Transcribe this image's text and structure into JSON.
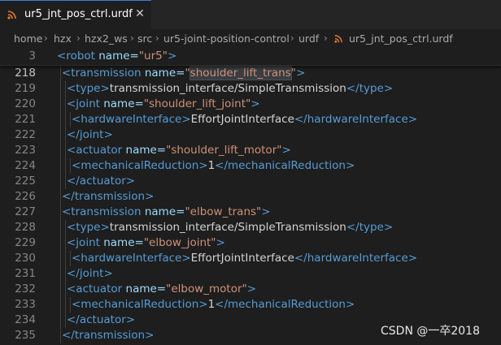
{
  "tab": {
    "label": "ur5_jnt_pos_ctrl.urdf",
    "close_glyph": "✕",
    "icon": "rss-icon"
  },
  "breadcrumb": [
    "home",
    "hzx",
    "hzx2_ws",
    "src",
    "ur5-joint-position-control",
    "urdf",
    "ur5_jnt_pos_ctrl.urdf"
  ],
  "sticky": {
    "number": "3",
    "tag_open": "<robot",
    "attr": " name=",
    "value": "\"ur5\"",
    "tag_close": ">"
  },
  "lines": [
    {
      "n": "218",
      "parts": [
        [
          "tag",
          "<transmission"
        ],
        [
          "attr",
          " name="
        ],
        [
          "str",
          "\"shoulder_lift_trans\"",
          "hl"
        ],
        [
          "tag",
          ">"
        ]
      ]
    },
    {
      "n": "219",
      "parts": [
        [
          "tag",
          "<type>"
        ],
        [
          "txt",
          "transmission_interface/SimpleTransmission"
        ],
        [
          "tag",
          "</type>"
        ]
      ]
    },
    {
      "n": "220",
      "parts": [
        [
          "tag",
          "<joint"
        ],
        [
          "attr",
          " name="
        ],
        [
          "str",
          "\"shoulder_lift_joint\""
        ],
        [
          "tag",
          ">"
        ]
      ]
    },
    {
      "n": "221",
      "parts": [
        [
          "tag",
          "<hardwareInterface>"
        ],
        [
          "txt",
          "EffortJointInterface"
        ],
        [
          "tag",
          "</hardwareInterface>"
        ]
      ]
    },
    {
      "n": "222",
      "parts": [
        [
          "tag",
          "</joint>"
        ]
      ]
    },
    {
      "n": "223",
      "parts": [
        [
          "tag",
          "<actuator"
        ],
        [
          "attr",
          " name="
        ],
        [
          "str",
          "\"shoulder_lift_motor\""
        ],
        [
          "tag",
          ">"
        ]
      ]
    },
    {
      "n": "224",
      "parts": [
        [
          "tag",
          "<mechanicalReduction>"
        ],
        [
          "txt",
          "1"
        ],
        [
          "tag",
          "</mechanicalReduction>"
        ]
      ]
    },
    {
      "n": "225",
      "parts": [
        [
          "tag",
          "</actuator>"
        ]
      ]
    },
    {
      "n": "226",
      "parts": [
        [
          "tag",
          "</transmission>"
        ]
      ]
    },
    {
      "n": "227",
      "parts": [
        [
          "tag",
          "<transmission"
        ],
        [
          "attr",
          " name="
        ],
        [
          "str",
          "\"elbow_trans\""
        ],
        [
          "tag",
          ">"
        ]
      ]
    },
    {
      "n": "228",
      "parts": [
        [
          "tag",
          "<type>"
        ],
        [
          "txt",
          "transmission_interface/SimpleTransmission"
        ],
        [
          "tag",
          "</type>"
        ]
      ]
    },
    {
      "n": "229",
      "parts": [
        [
          "tag",
          "<joint"
        ],
        [
          "attr",
          " name="
        ],
        [
          "str",
          "\"elbow_joint\""
        ],
        [
          "tag",
          ">"
        ]
      ]
    },
    {
      "n": "230",
      "parts": [
        [
          "tag",
          "<hardwareInterface>"
        ],
        [
          "txt",
          "EffortJointInterface"
        ],
        [
          "tag",
          "</hardwareInterface>"
        ]
      ]
    },
    {
      "n": "231",
      "parts": [
        [
          "tag",
          "</joint>"
        ]
      ]
    },
    {
      "n": "232",
      "parts": [
        [
          "tag",
          "<actuator"
        ],
        [
          "attr",
          " name="
        ],
        [
          "str",
          "\"elbow_motor\""
        ],
        [
          "tag",
          ">"
        ]
      ]
    },
    {
      "n": "233",
      "parts": [
        [
          "tag",
          "<mechanicalReduction>"
        ],
        [
          "txt",
          "1"
        ],
        [
          "tag",
          "</mechanicalReduction>"
        ]
      ]
    },
    {
      "n": "234",
      "parts": [
        [
          "tag",
          "</actuator>"
        ]
      ]
    },
    {
      "n": "235",
      "parts": [
        [
          "tag",
          "</transmission>"
        ]
      ]
    }
  ],
  "watermark": "CSDN @一卒2018",
  "colors": {
    "tag": "#569cd6",
    "attr": "#9cdcfe",
    "string": "#ce9178",
    "text": "#d4d4d4",
    "rss": "#e37933"
  }
}
